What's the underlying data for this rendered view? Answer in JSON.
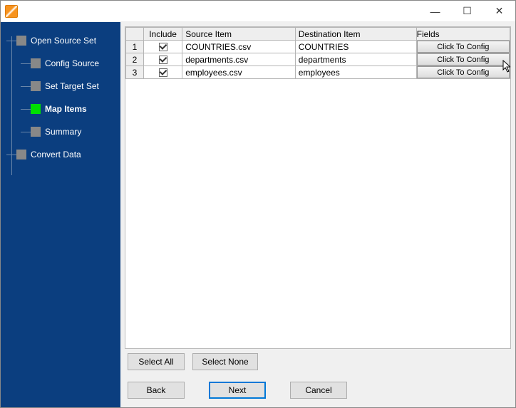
{
  "window": {
    "minimize_glyph": "—",
    "maximize_glyph": "☐",
    "close_glyph": "✕"
  },
  "sidebar": {
    "steps": [
      {
        "label": "Open Source Set",
        "child": false,
        "current": false
      },
      {
        "label": "Config Source",
        "child": true,
        "current": false
      },
      {
        "label": "Set Target Set",
        "child": true,
        "current": false
      },
      {
        "label": "Map Items",
        "child": true,
        "current": true
      },
      {
        "label": "Summary",
        "child": true,
        "current": false
      },
      {
        "label": "Convert Data",
        "child": false,
        "current": false
      }
    ]
  },
  "grid": {
    "headers": {
      "rownum": "",
      "include": "Include",
      "source": "Source Item",
      "dest": "Destination Item",
      "fields": "Fields"
    },
    "config_btn_label": "Click To Config",
    "rows": [
      {
        "n": "1",
        "include": true,
        "source": "COUNTRIES.csv",
        "dest": "COUNTRIES"
      },
      {
        "n": "2",
        "include": true,
        "source": "departments.csv",
        "dest": "departments"
      },
      {
        "n": "3",
        "include": true,
        "source": "employees.csv",
        "dest": "employees"
      }
    ]
  },
  "buttons": {
    "select_all": "Select All",
    "select_none": "Select None",
    "back": "Back",
    "next": "Next",
    "cancel": "Cancel"
  }
}
